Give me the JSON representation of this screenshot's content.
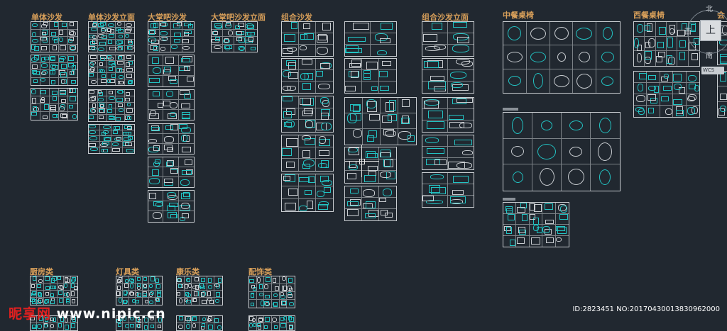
{
  "canvas": {
    "background": "#212830",
    "line_color": "#c8ccd0",
    "accent_color": "#22c3c3",
    "label_color": "#d9a05a"
  },
  "sections": {
    "s1": "单体沙发",
    "s2": "单体沙发立面",
    "s3": "大堂吧沙发",
    "s4": "大堂吧沙发立面",
    "s5": "组合沙发",
    "s6": "组合沙发立面",
    "s7": "中餐桌椅",
    "s8": "西餐桌椅",
    "s9": "厨房类",
    "s10": "灯具类",
    "s11": "康乐类",
    "s12": "配饰类"
  },
  "edge_label": "会",
  "viewcube": {
    "north": "北",
    "west": "西",
    "south": "南",
    "top_face": "上",
    "wcs": "WCS"
  },
  "watermark": {
    "site_red": "昵享网",
    "site_white": " www.nipic.cn",
    "id_text": "ID:2823451 NO:20170430013830962000"
  }
}
